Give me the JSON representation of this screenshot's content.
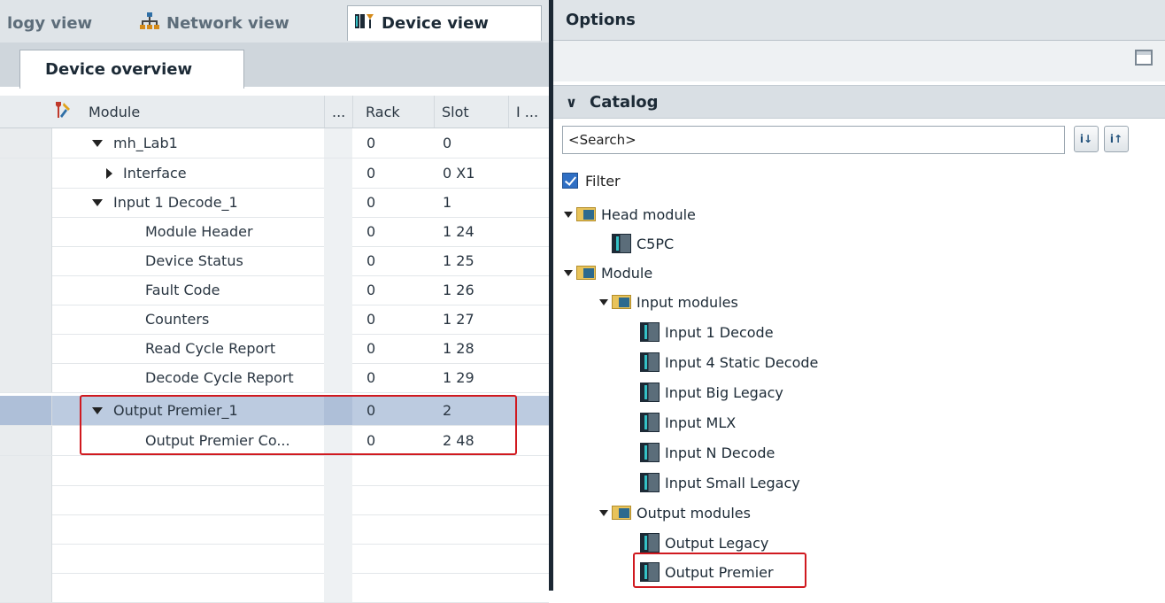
{
  "view_tabs": {
    "topology": "logy view",
    "network": "Network view",
    "device": "Device view"
  },
  "device_overview_tab": "Device overview",
  "table": {
    "headers": {
      "module": "Module",
      "dots": "...",
      "rack": "Rack",
      "slot": "Slot",
      "i": "I ..."
    },
    "rows": [
      {
        "module": "mh_Lab1",
        "rack": "0",
        "slot": "0"
      },
      {
        "module": "Interface",
        "rack": "0",
        "slot": "0 X1"
      },
      {
        "module": "Input 1 Decode_1",
        "rack": "0",
        "slot": "1"
      },
      {
        "module": "Module Header",
        "rack": "0",
        "slot": "1 24"
      },
      {
        "module": "Device Status",
        "rack": "0",
        "slot": "1 25"
      },
      {
        "module": "Fault Code",
        "rack": "0",
        "slot": "1 26"
      },
      {
        "module": "Counters",
        "rack": "0",
        "slot": "1 27"
      },
      {
        "module": "Read Cycle Report",
        "rack": "0",
        "slot": "1 28"
      },
      {
        "module": "Decode Cycle Report",
        "rack": "0",
        "slot": "1 29"
      },
      {
        "module": "Output Premier_1",
        "rack": "0",
        "slot": "2"
      },
      {
        "module": "Output Premier Co...",
        "rack": "0",
        "slot": "2 48"
      }
    ]
  },
  "options_title": "Options",
  "catalog": {
    "title": "Catalog",
    "search_value": "<Search>",
    "filter_label": "Filter",
    "tree": {
      "head_module": "Head module",
      "c5pc": "C5PC",
      "module": "Module",
      "input_modules": "Input modules",
      "inputs": [
        "Input 1 Decode",
        "Input 4 Static Decode",
        "Input Big Legacy",
        "Input MLX",
        "Input N Decode",
        "Input Small Legacy"
      ],
      "output_modules": "Output modules",
      "outputs": [
        "Output Legacy",
        "Output Premier"
      ]
    }
  }
}
